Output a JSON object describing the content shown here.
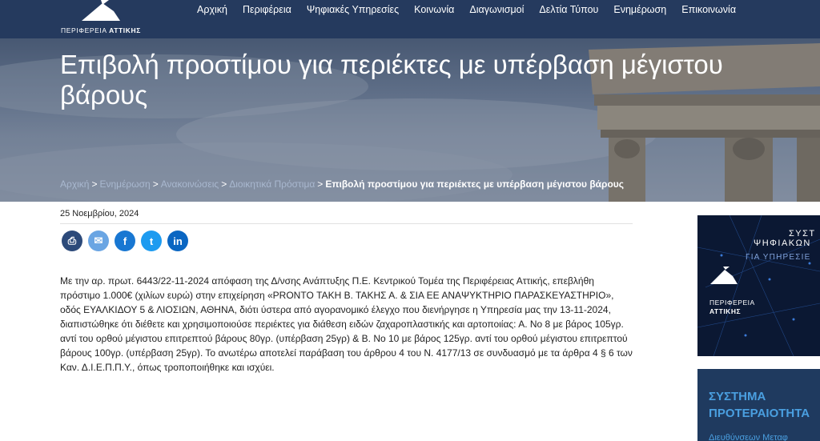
{
  "header": {
    "logo_text_regular": "ΠΕΡΙΦΕΡΕΙΑ",
    "logo_text_bold": "ΑΤΤΙΚΗΣ",
    "nav": [
      {
        "label": "Αρχική"
      },
      {
        "label": "Περιφέρεια"
      },
      {
        "label": "Ψηφιακές Υπηρεσίες"
      },
      {
        "label": "Κοινωνία"
      },
      {
        "label": "Διαγωνισμοί"
      },
      {
        "label": "Δελτία Τύπου"
      },
      {
        "label": "Ενημέρωση"
      },
      {
        "label": "Επικοινωνία"
      }
    ]
  },
  "hero": {
    "title": "Επιβολή προστίμου για περιέκτες με υπέρβαση μέγιστου βάρους"
  },
  "breadcrumb": {
    "items": [
      "Αρχική",
      "Ενημέρωση",
      "Ανακοινώσεις",
      "Διοικητικά Πρόστιμα"
    ],
    "separator": ">",
    "current": "Επιβολή προστίμου για περιέκτες με υπέρβαση μέγιστου βάρους"
  },
  "article": {
    "date": "25 Νοεμβρίου, 2024",
    "share": [
      {
        "name": "print",
        "color": "#2c4a7a",
        "glyph": "⎙"
      },
      {
        "name": "email",
        "color": "#6aa5e3",
        "glyph": "✉"
      },
      {
        "name": "facebook",
        "color": "#1877d2",
        "glyph": "f"
      },
      {
        "name": "twitter",
        "color": "#1d9bf0",
        "glyph": "t"
      },
      {
        "name": "linkedin",
        "color": "#0a66c2",
        "glyph": "in"
      }
    ],
    "body": "Με την αρ. πρωτ. 6443/22-11-2024 απόφαση της Δ/νσης Ανάπτυξης Π.Ε. Κεντρικού Τομέα της Περιφέρειας Αττικής, επεβλήθη πρόστιμο 1.000€ (χιλίων ευρώ) στην επιχείρηση «PRONTO ΤΑΚΗ Β. ΤΑΚΗΣ Α. & ΣΙΑ ΕΕ ΑΝΑΨΥΚΤΗΡΙΟ ΠΑΡΑΣΚΕΥΑΣΤΗΡΙΟ», οδός ΕΥΑΛΚΙΔΟΥ 5 & ΛΙΟΣΙΩΝ, ΑΘΗΝΑ, διότι ύστερα από αγορανομικό έλεγχο που διενήργησε η Υπηρεσία μας την 13-11-2024, διαπιστώθηκε ότι διέθετε και χρησιμοποιούσε περιέκτες για διάθεση ειδών ζαχαροπλαστικής και αρτοποιίας: Α. Νο 8 με βάρος 105γρ. αντί του ορθού μέγιστου επιτρεπτού βάρους 80γρ. (υπέρβαση 25γρ) & Β. Νο 10 με βάρος 125γρ. αντί του ορθού μέγιστου επιτρεπτού βάρους 100γρ. (υπέρβαση 25γρ).  Το ανωτέρω αποτελεί παράβαση του άρθρου 4 του Ν. 4177/13 σε συνδυασμό με τα άρθρα 4 § 6 των Καν. Δ.Ι.Ε.Π.Π.Υ., όπως τροποποιήθηκε και ισχύει."
  },
  "sidebar": {
    "banner1": {
      "line1": "ΣΥΣΤ",
      "line2": "ΨΗΦΙΑΚΩΝ",
      "line3": "ΓΙΑ ΥΠΗΡΕΣΙΕ",
      "org_regular": "ΠΕΡΙΦΕΡΕΙΑ",
      "org_bold": "ΑΤΤΙΚΗΣ"
    },
    "banner2": {
      "line1": "ΣΥΣΤΗΜΑ",
      "line2": "ΠΡΟΤΕΡΑΙΟΤΗΤΑ",
      "line3": "Διευθύνσεων Μεταφ"
    }
  }
}
